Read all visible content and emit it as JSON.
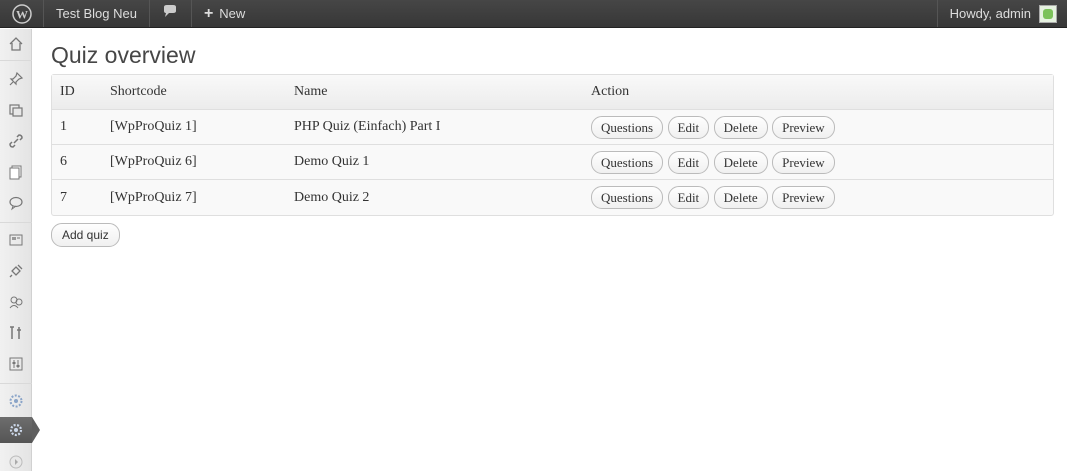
{
  "adminbar": {
    "wp_logo_icon": "wordpress-logo-icon",
    "site_name": "Test Blog Neu",
    "comments_icon": "comment-bubble-icon",
    "new_label": "New",
    "greeting": "Howdy, admin"
  },
  "sidebar": {
    "icons": [
      "dashboard-icon",
      "posts-pin-icon",
      "media-icon",
      "links-icon",
      "pages-icon",
      "comments-icon",
      "appearance-icon",
      "plugins-icon",
      "users-icon",
      "tools-icon",
      "settings-icon",
      "wpproquiz-icon",
      "gear-icon",
      "collapse-icon"
    ]
  },
  "page": {
    "title": "Quiz overview"
  },
  "table": {
    "headers": {
      "id": "ID",
      "shortcode": "Shortcode",
      "name": "Name",
      "action": "Action"
    },
    "rows": [
      {
        "id": "1",
        "shortcode": "[WpProQuiz 1]",
        "name": "PHP Quiz (Einfach) Part I"
      },
      {
        "id": "6",
        "shortcode": "[WpProQuiz 6]",
        "name": "Demo Quiz 1"
      },
      {
        "id": "7",
        "shortcode": "[WpProQuiz 7]",
        "name": "Demo Quiz 2"
      }
    ],
    "actions": {
      "questions": "Questions",
      "edit": "Edit",
      "delete": "Delete",
      "preview": "Preview"
    }
  },
  "add_quiz_label": "Add quiz",
  "colors": {
    "adminbar_bg": "#464646",
    "sidebar_bg": "#ececec",
    "current_menu": "#5f5f5f"
  }
}
